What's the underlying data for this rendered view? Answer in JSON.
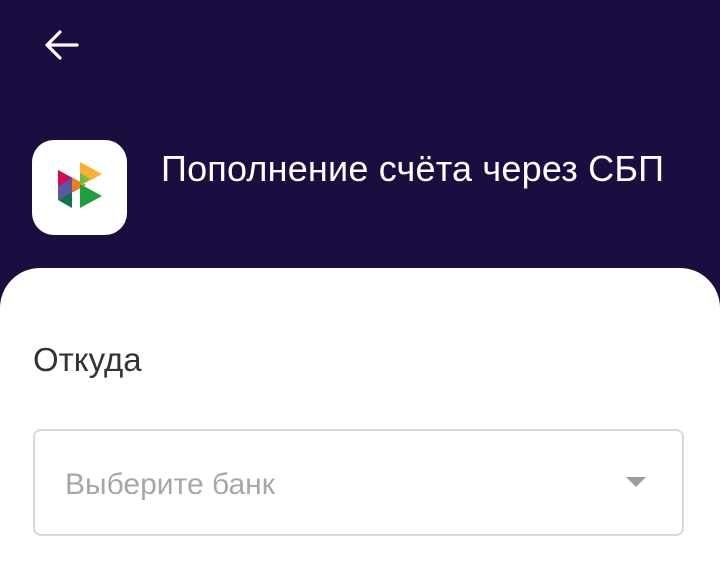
{
  "header": {
    "back_icon": "arrow-left-icon",
    "title": "Пополнение счёта через СБП",
    "logo_icon": "sbp-logo-icon"
  },
  "form": {
    "from_label": "Откуда",
    "bank_select": {
      "placeholder": "Выберите банк",
      "icon": "chevron-down-icon"
    }
  },
  "colors": {
    "header_background": "#1a0d3f",
    "surface": "#ffffff",
    "label_text": "#333333",
    "placeholder_text": "#a7a7a7",
    "field_border": "#d9d9d9"
  }
}
